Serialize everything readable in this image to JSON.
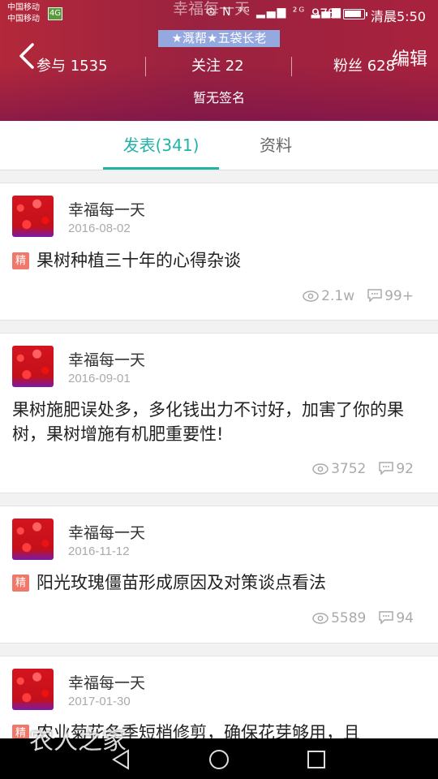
{
  "status_bar": {
    "carrier_line1": "中国移动",
    "carrier_line2": "中国移动",
    "carrier_badge": "4G",
    "network_icons": "⊙ N ⁴ᴳ ▂▄▆ ²ᴳ ▂▄▆",
    "battery_percent": "97%",
    "time": "清晨5:50"
  },
  "header": {
    "ghost_title": "幸福每一天",
    "rank_badge": "★溉帮★五袋长老",
    "edit_label": "编辑",
    "stats": [
      {
        "label": "参与 1535"
      },
      {
        "label": "关注 22"
      },
      {
        "label": "粉丝 628"
      }
    ],
    "signature": "暂无签名",
    "colors": {
      "accent": "#a8223d",
      "tab_active": "#21b3a6"
    }
  },
  "tabs": [
    {
      "label": "发表(341)",
      "active": true
    },
    {
      "label": "资料",
      "active": false
    }
  ],
  "posts": [
    {
      "author": "幸福每一天",
      "date": "2016-08-02",
      "essence": true,
      "essence_label": "精",
      "title": "果树种植三十年的心得杂谈",
      "views": "2.1w",
      "comments": "99+"
    },
    {
      "author": "幸福每一天",
      "date": "2016-09-01",
      "essence": false,
      "essence_label": "",
      "title": "果树施肥误处多，多化钱出力不讨好，加害了你的果树，果树增施有机肥重要性!",
      "views": "3752",
      "comments": "92"
    },
    {
      "author": "幸福每一天",
      "date": "2016-11-12",
      "essence": true,
      "essence_label": "精",
      "title": "阳光玫瑰僵苗形成原因及对策谈点看法",
      "views": "5589",
      "comments": "94"
    },
    {
      "author": "幸福每一天",
      "date": "2017-01-30",
      "essence": true,
      "essence_label": "精",
      "title": "农业菊花冬季短梢修剪，确保花芽够用，且",
      "views": "",
      "comments": ""
    }
  ],
  "watermark": "农人之家",
  "icons": {
    "views": "eye-icon",
    "comments": "comment-icon",
    "back": "chevron-left-icon"
  }
}
